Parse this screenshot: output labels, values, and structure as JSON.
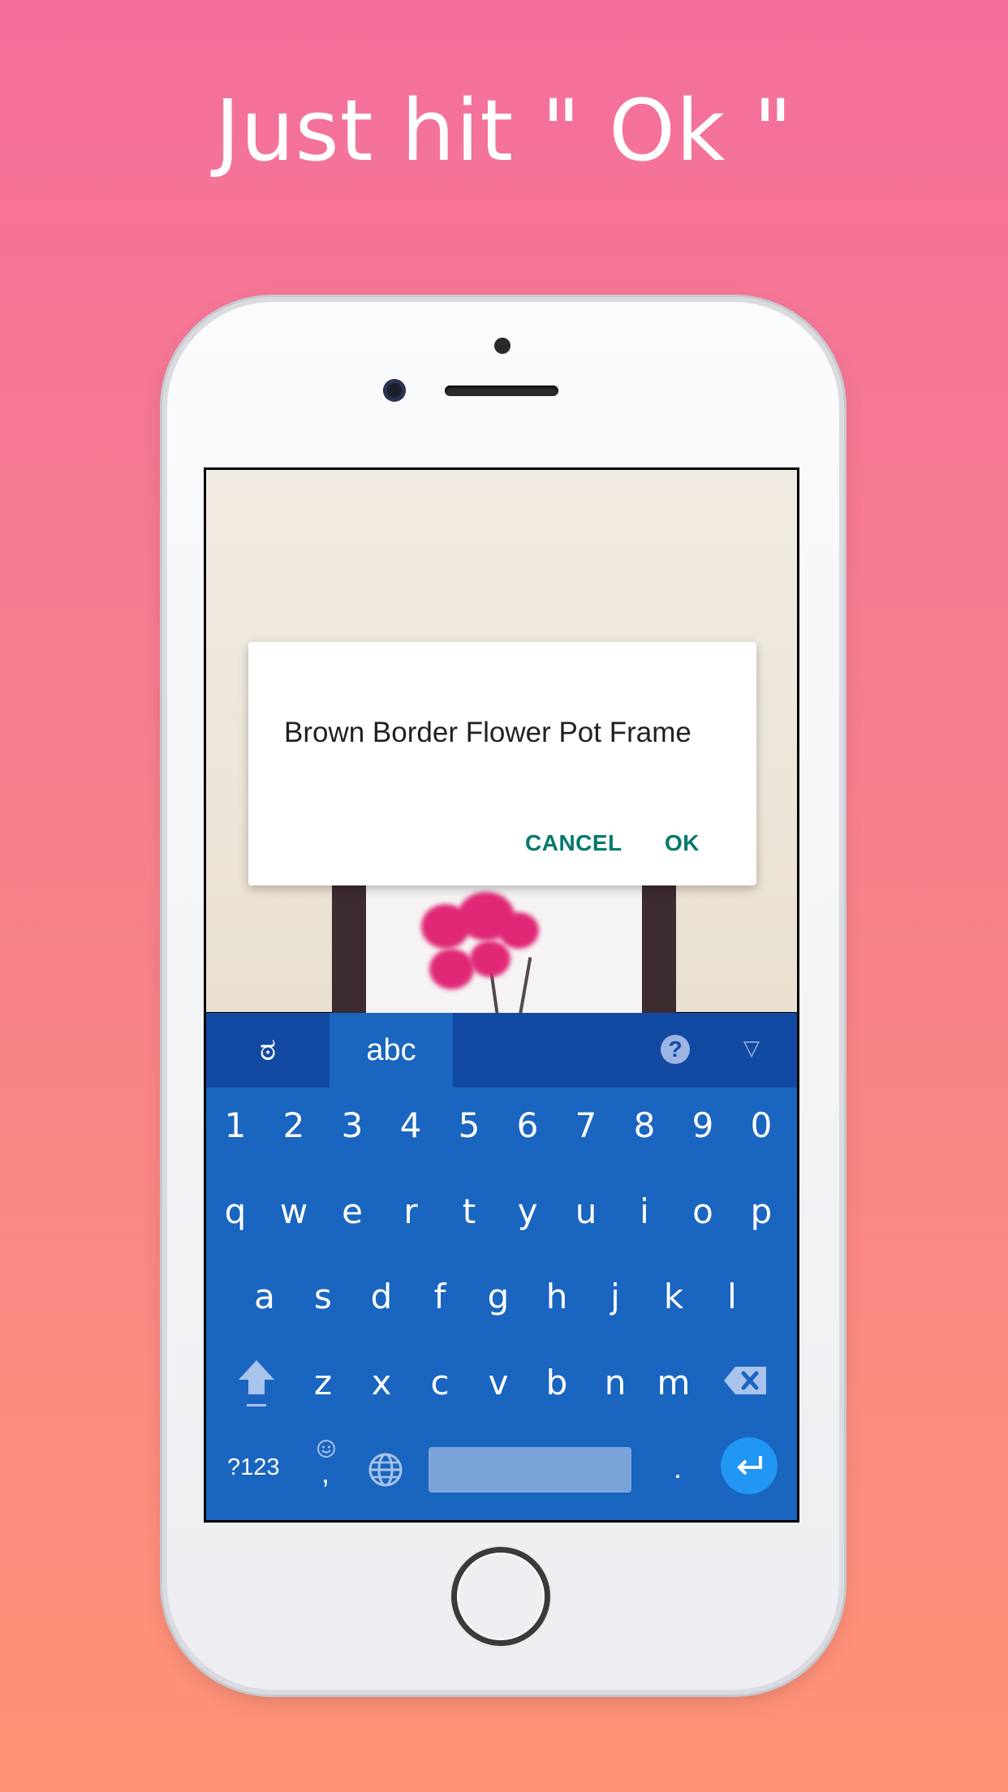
{
  "headline": "Just hit  \" Ok \"",
  "dialog": {
    "message": "Brown Border Flower Pot Frame",
    "cancel_label": "CANCEL",
    "ok_label": "OK"
  },
  "keyboard": {
    "lang_tabs": [
      "ಠ",
      "abc"
    ],
    "help_label": "?",
    "collapse_icon": "▽",
    "number_row": [
      "1",
      "2",
      "3",
      "4",
      "5",
      "6",
      "7",
      "8",
      "9",
      "0"
    ],
    "row1": [
      "q",
      "w",
      "e",
      "r",
      "t",
      "y",
      "u",
      "i",
      "o",
      "p"
    ],
    "row2": [
      "a",
      "s",
      "d",
      "f",
      "g",
      "h",
      "j",
      "k",
      "l"
    ],
    "row3": [
      "z",
      "x",
      "c",
      "v",
      "b",
      "n",
      "m"
    ],
    "symbols_label": "?123",
    "comma_label": ",",
    "period_label": ".",
    "shift_icon": "shift-icon",
    "backspace_icon": "backspace-icon",
    "emoji_icon": "emoji-icon",
    "globe_icon": "globe-icon",
    "enter_icon": "enter-icon"
  },
  "colors": {
    "accent_dialog": "#00796b",
    "keyboard_bg": "#1a65bf",
    "keyboard_top": "#1249a3",
    "enter_key": "#2196f3"
  }
}
